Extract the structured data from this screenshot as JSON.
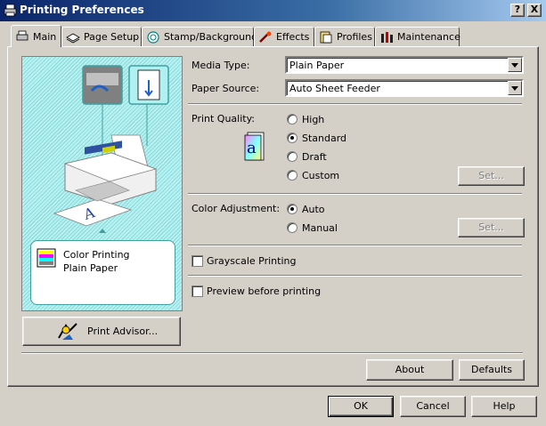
{
  "window": {
    "title": "Printing Preferences",
    "help_button": "?",
    "close_button": "X"
  },
  "tabs": [
    {
      "label": "Main",
      "icon": "printer-icon",
      "active": true
    },
    {
      "label": "Page Setup",
      "icon": "pages-icon"
    },
    {
      "label": "Stamp/Background",
      "icon": "stamp-icon"
    },
    {
      "label": "Effects",
      "icon": "effects-icon"
    },
    {
      "label": "Profiles",
      "icon": "profiles-icon"
    },
    {
      "label": "Maintenance",
      "icon": "maintenance-icon"
    }
  ],
  "preview": {
    "status_line1": "Color Printing",
    "status_line2": "Plain Paper"
  },
  "print_advisor_button": "Print Advisor...",
  "media_type": {
    "label": "Media Type:",
    "value": "Plain Paper"
  },
  "paper_source": {
    "label": "Paper Source:",
    "value": "Auto Sheet Feeder"
  },
  "print_quality": {
    "label": "Print Quality:",
    "options": [
      "High",
      "Standard",
      "Draft",
      "Custom"
    ],
    "selected": "Standard",
    "set_button": "Set..."
  },
  "color_adjustment": {
    "label": "Color Adjustment:",
    "options": [
      "Auto",
      "Manual"
    ],
    "selected": "Auto",
    "set_button": "Set..."
  },
  "grayscale": {
    "label": "Grayscale Printing",
    "checked": false
  },
  "preview_before": {
    "label": "Preview before printing",
    "checked": false
  },
  "about_button": "About",
  "defaults_button": "Defaults",
  "ok_button": "OK",
  "cancel_button": "Cancel",
  "help_button": "Help"
}
